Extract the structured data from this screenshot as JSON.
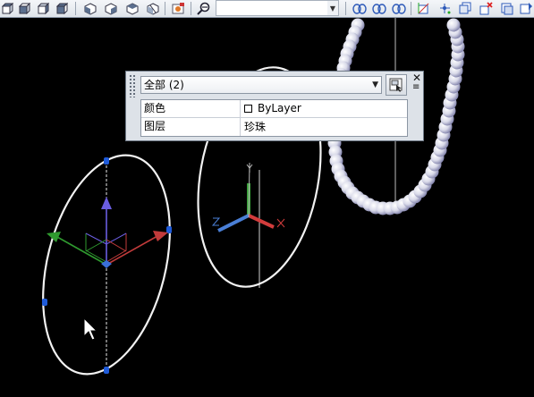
{
  "toolbar": {
    "buttons": [
      {
        "name": "view-cube-icon",
        "kind": "cube"
      },
      {
        "name": "view-cube-left-icon",
        "kind": "cube"
      },
      {
        "name": "view-cube-front-icon",
        "kind": "cube"
      },
      {
        "name": "view-cube-right-icon",
        "kind": "cube"
      },
      {
        "name": "view-cube-back-icon",
        "kind": "cube"
      },
      {
        "name": "iso-sw-icon",
        "kind": "iso"
      },
      {
        "name": "iso-se-icon",
        "kind": "iso"
      },
      {
        "name": "iso-ne-icon",
        "kind": "iso"
      },
      {
        "name": "iso-nw-icon",
        "kind": "iso"
      },
      {
        "name": "named-view-icon",
        "kind": "camera"
      },
      {
        "name": "zoom-realtime-icon",
        "kind": "zoom"
      }
    ],
    "layer_combo": {
      "value": ""
    },
    "right_buttons": [
      "ucs-world-icon",
      "ucs-object-icon",
      "ucs-face-icon",
      "ucs-3point-icon",
      "ucs-origin-icon",
      "ucs-view-icon",
      "ucs-delete-icon",
      "ucs-apply-icon"
    ]
  },
  "quick_properties": {
    "selection_label": "全部 (2)",
    "close_glyph": "✕",
    "menu_glyph": "≡",
    "rows": [
      {
        "name": "颜色",
        "value": "ByLayer",
        "swatch": true
      },
      {
        "name": "图层",
        "value": "珍珠",
        "swatch": false
      }
    ]
  },
  "colors": {
    "background": "#000000",
    "ellipse": "#f2f2f2",
    "grip": "#1f5bd9",
    "pearl": "#d8d9ea",
    "axis_x": "#d23c3c",
    "axis_y": "#3fa33f",
    "axis_z": "#4a7fd6"
  }
}
